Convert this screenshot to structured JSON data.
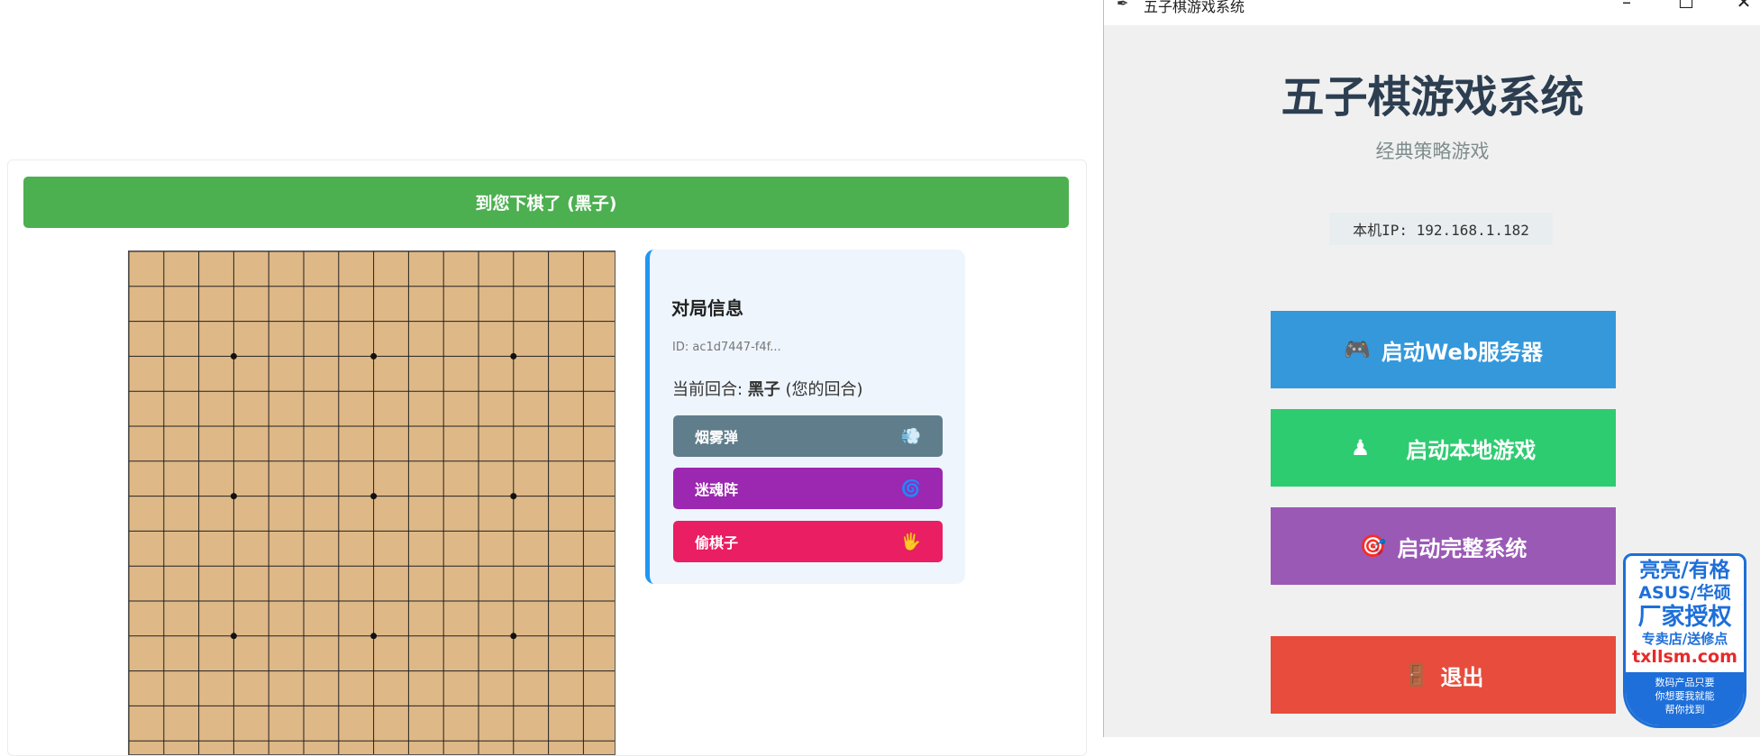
{
  "web": {
    "turn_banner": "到您下棋了 (黑子)",
    "board": {
      "lines": 15,
      "star_points": [
        [
          3,
          3
        ],
        [
          3,
          7
        ],
        [
          3,
          11
        ],
        [
          7,
          3
        ],
        [
          7,
          7
        ],
        [
          7,
          11
        ],
        [
          11,
          3
        ],
        [
          11,
          7
        ],
        [
          11,
          11
        ]
      ]
    },
    "info": {
      "title": "对局信息",
      "game_id": "ID: ac1d7447-f4f...",
      "turn_prefix": "当前回合: ",
      "turn_color": "黑子",
      "turn_suffix": " (您的回合)"
    },
    "skills": [
      {
        "label": "烟雾弹",
        "icon": "💨",
        "icon_name": "smoke-icon",
        "color": "#607d8b"
      },
      {
        "label": "迷魂阵",
        "icon": "🌀",
        "icon_name": "swirl-icon",
        "color": "#9c27b0"
      },
      {
        "label": "偷棋子",
        "icon": "🖐",
        "icon_name": "hand-icon",
        "color": "#e91e63"
      }
    ]
  },
  "window": {
    "title": "五子棋游戏系统",
    "controls": {
      "minimize": "–",
      "maximize": "☐",
      "close": "✕"
    },
    "heading": "五子棋游戏系统",
    "subtitle": "经典策略游戏",
    "ip_label": "本机IP: 192.168.1.182",
    "buttons": {
      "web_server": {
        "icon": "🎮",
        "label": "启动Web服务器",
        "color": "#3498db"
      },
      "local_game": {
        "icon": "♟",
        "label": "启动本地游戏",
        "color": "#2ecc71"
      },
      "full_system": {
        "icon": "🎯",
        "label": "启动完整系统",
        "color": "#9b59b6"
      },
      "quit": {
        "icon": "🚪",
        "label": "退出",
        "color": "#e74c3c"
      }
    }
  },
  "ad_badge": {
    "line1": "亮亮/有格",
    "line2": "ASUS/华硕",
    "line3": "厂家授权",
    "line4": "专卖店/送修点",
    "line5": "txllsm.com",
    "footer1": "数码产品只要",
    "footer2": "你想要我就能",
    "footer3": "帮你找到"
  }
}
